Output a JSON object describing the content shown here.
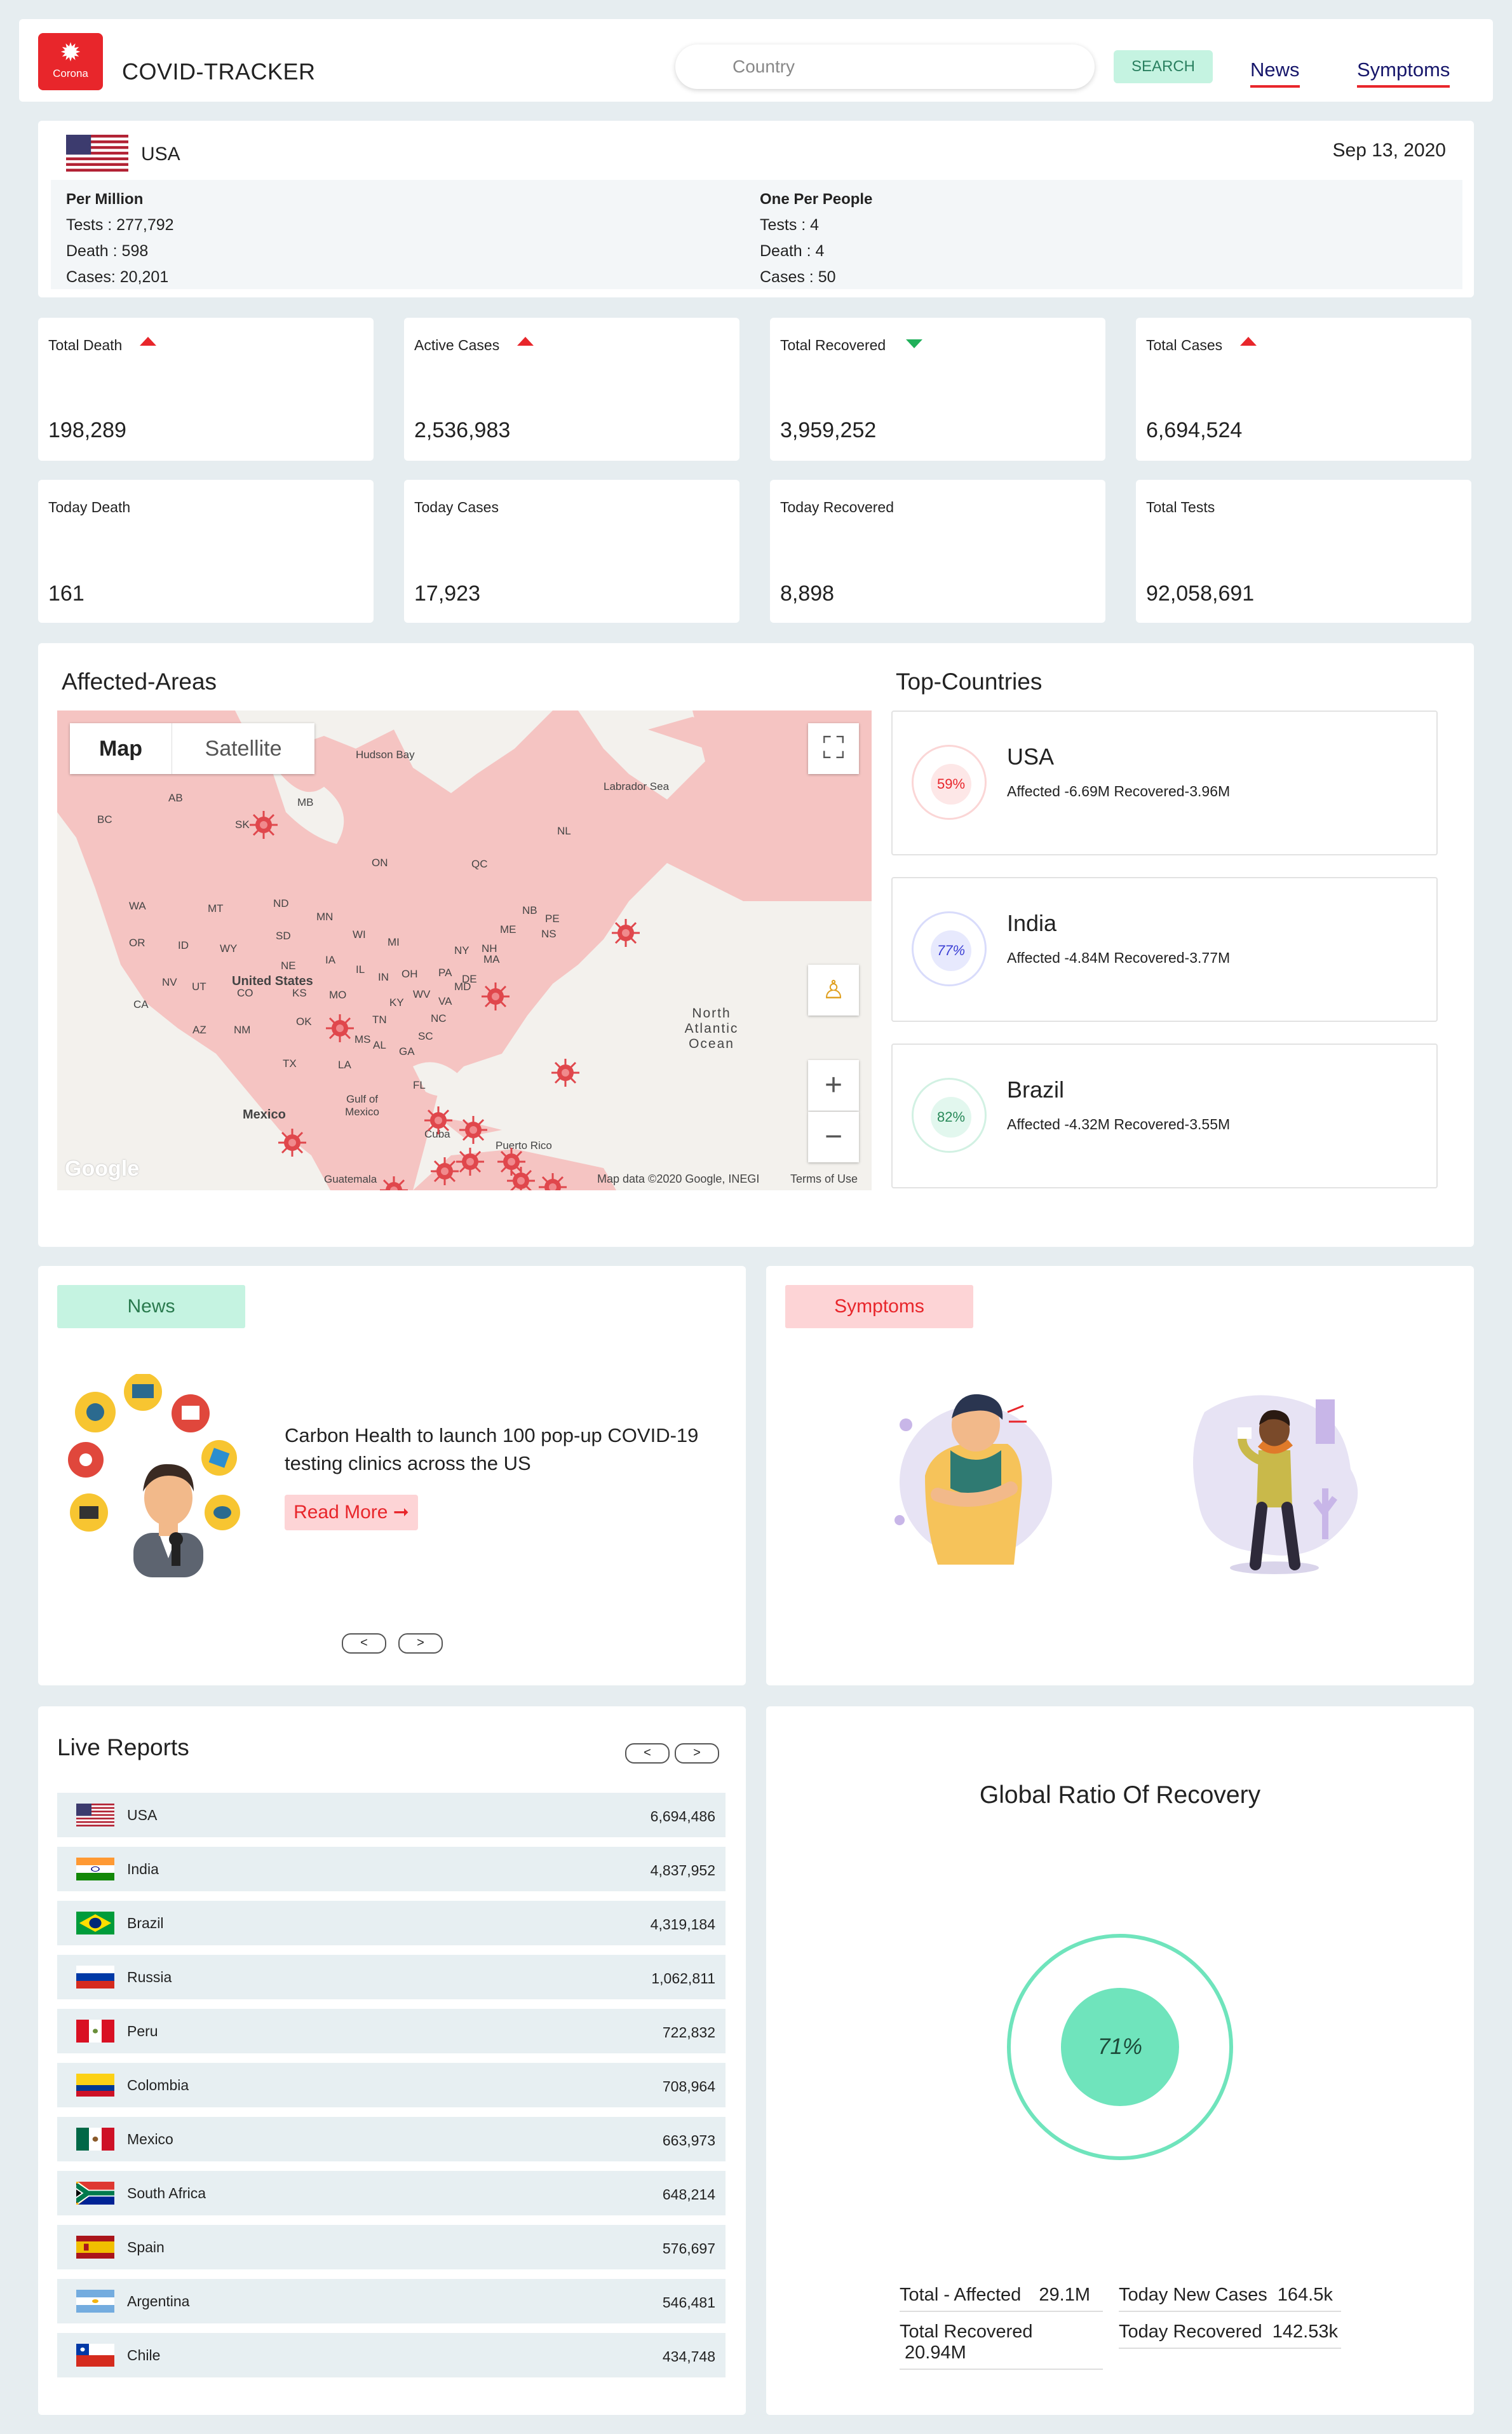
{
  "header": {
    "logo_label": "Corona",
    "title": "COVID-TRACKER",
    "search_placeholder": "Country",
    "search_button": "SEARCH",
    "nav": [
      "News",
      "Symptoms"
    ]
  },
  "country": {
    "name": "USA",
    "date": "Sep 13, 2020",
    "per_million": {
      "heading": "Per Million",
      "tests": "Tests   : 277,792",
      "death": "Death : 598",
      "cases": "Cases: 20,201"
    },
    "one_per_people": {
      "heading": "One Per People",
      "tests": "Tests   : 4",
      "death": "Death : 4",
      "cases": "Cases : 50"
    }
  },
  "stats": [
    {
      "label": "Total Death",
      "value": "198,289",
      "trend": "up"
    },
    {
      "label": "Active Cases",
      "value": "2,536,983",
      "trend": "up"
    },
    {
      "label": "Total Recovered",
      "value": "3,959,252",
      "trend": "down"
    },
    {
      "label": "Total Cases",
      "value": "6,694,524",
      "trend": "up"
    },
    {
      "label": "Today Death",
      "value": "161"
    },
    {
      "label": "Today Cases",
      "value": "17,923"
    },
    {
      "label": "Today Recovered",
      "value": "8,898"
    },
    {
      "label": "Total Tests",
      "value": "92,058,691"
    }
  ],
  "affected": {
    "title": "Affected-Areas",
    "map_tab": "Map",
    "satellite_tab": "Satellite",
    "footer_data": "Map data ©2020 Google, INEGI",
    "footer_terms": "Terms of Use",
    "google": "Google",
    "labels": [
      "Hudson Bay",
      "Labrador Sea",
      "United States",
      "North Atlantic Ocean",
      "Gulf of Mexico",
      "Mexico",
      "Cuba",
      "Puerto Rico",
      "Guatemala",
      "AB",
      "BC",
      "SK",
      "MB",
      "ON",
      "QC",
      "NL",
      "WA",
      "MT",
      "ND",
      "MN",
      "OR",
      "ID",
      "WY",
      "SD",
      "WI",
      "MI",
      "NY",
      "ME",
      "NB",
      "PE",
      "NS",
      "NV",
      "UT",
      "CO",
      "KS",
      "NE",
      "IA",
      "IL",
      "IN",
      "OH",
      "PA",
      "NH",
      "MA",
      "CA",
      "AZ",
      "NM",
      "OK",
      "MO",
      "KY",
      "WV",
      "VA",
      "MD",
      "DE",
      "TX",
      "LA",
      "MS",
      "AL",
      "TN",
      "GA",
      "SC",
      "NC",
      "FL"
    ]
  },
  "top_countries": {
    "title": "Top-Countries",
    "items": [
      {
        "name": "USA",
        "percent": "59%",
        "stats": "Affected -6.69M   Recovered-3.96M",
        "color": "#e8262b"
      },
      {
        "name": "India",
        "percent": "77%",
        "stats": "Affected -4.84M   Recovered-3.77M",
        "color": "#3b3fd4"
      },
      {
        "name": "Brazil",
        "percent": "82%",
        "stats": "Affected -4.32M   Recovered-3.55M",
        "color": "#2a8a5a"
      }
    ]
  },
  "news": {
    "tag": "News",
    "headline": "Carbon Health to launch 100 pop-up COVID-19 testing clinics across the US",
    "read_more": "Read More ➞",
    "prev": "<",
    "next": ">"
  },
  "symptoms": {
    "tag": "Symptoms"
  },
  "live_reports": {
    "title": "Live Reports",
    "prev": "<",
    "next": ">",
    "rows": [
      {
        "country": "USA",
        "value": "6,694,486"
      },
      {
        "country": "India",
        "value": "4,837,952"
      },
      {
        "country": "Brazil",
        "value": "4,319,184"
      },
      {
        "country": "Russia",
        "value": "1,062,811"
      },
      {
        "country": "Peru",
        "value": "722,832"
      },
      {
        "country": "Colombia",
        "value": "708,964"
      },
      {
        "country": "Mexico",
        "value": "663,973"
      },
      {
        "country": "South Africa",
        "value": "648,214"
      },
      {
        "country": "Spain",
        "value": "576,697"
      },
      {
        "country": "Argentina",
        "value": "546,481"
      },
      {
        "country": "Chile",
        "value": "434,748"
      }
    ]
  },
  "global_ratio": {
    "title": "Global Ratio Of Recovery",
    "percent": "71%",
    "total_affected_label": "Total - Affected",
    "total_affected": "29.1M",
    "today_new_cases_label": "Today New Cases",
    "today_new_cases": "164.5k",
    "total_recovered_label": "Total Recovered",
    "total_recovered": "20.94M",
    "today_recovered_label": "Today Recovered",
    "today_recovered": "142.53k"
  }
}
